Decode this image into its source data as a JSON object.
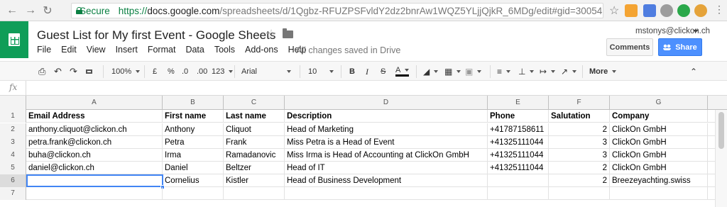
{
  "browser": {
    "secure_label": "Secure",
    "url_proto": "https://",
    "url_host": "docs.google.com",
    "url_path": "/spreadsheets/d/1Qgbz-RFUZPSFvldY2dz2bnrAw1WQZ5YLjjQjkR_6MDg/edit#gid=30054..."
  },
  "doc": {
    "title": "Guest List for My first Event - Google Sheets",
    "saved_status": "All changes saved in Drive",
    "account": "mstonys@clickon.ch"
  },
  "menu": [
    "File",
    "Edit",
    "View",
    "Insert",
    "Format",
    "Data",
    "Tools",
    "Add-ons",
    "Help"
  ],
  "buttons": {
    "comments": "Comments",
    "share": "Share"
  },
  "toolbar": {
    "zoom": "100%",
    "currency": "£",
    "percent": "%",
    "dec_less": ".0",
    "dec_more": ".00",
    "more_formats": "123",
    "font": "Arial",
    "font_size": "10",
    "bold": "B",
    "italic": "I",
    "strike": "S",
    "text_color": "A",
    "more": "More"
  },
  "formula_bar": {
    "fx": "fx",
    "value": ""
  },
  "columns": [
    "A",
    "B",
    "C",
    "D",
    "E",
    "F",
    "G"
  ],
  "rows": [
    {
      "num": "1",
      "cells": [
        "Email Address",
        "First name",
        "Last name",
        "Description",
        "Phone",
        "Salutation",
        "Company"
      ]
    },
    {
      "num": "2",
      "cells": [
        "anthony.cliquot@clickon.ch",
        "Anthony",
        "Cliquot",
        "Head of Marketing",
        "+41787158611",
        "2",
        "ClickOn GmbH"
      ]
    },
    {
      "num": "3",
      "cells": [
        "petra.frank@clickon.ch",
        "Petra",
        "Frank",
        "Miss Petra is a Head of Event",
        "+41325111044",
        "3",
        "ClickOn GmbH"
      ]
    },
    {
      "num": "4",
      "cells": [
        "buha@clickon.ch",
        "Irma",
        "Ramadanovic",
        "Miss Irma is Head of Accounting at ClickOn GmbH",
        "+41325111044",
        "3",
        "ClickOn GmbH"
      ]
    },
    {
      "num": "5",
      "cells": [
        "daniel@clickon.ch",
        "Daniel",
        "Beltzer",
        "Head of IT",
        "+41325111044",
        "2",
        "ClickOn GmbH"
      ]
    },
    {
      "num": "6",
      "cells": [
        "",
        "Cornelius",
        "Kistler",
        "Head of Business Development",
        "",
        "2",
        "Breezeyachting.swiss"
      ]
    },
    {
      "num": "7",
      "cells": [
        "",
        "",
        "",
        "",
        "",
        "",
        ""
      ]
    }
  ],
  "colors": {
    "sheets_green": "#0f9d58",
    "share_blue": "#4d90fe",
    "selection": "#4285f4"
  }
}
